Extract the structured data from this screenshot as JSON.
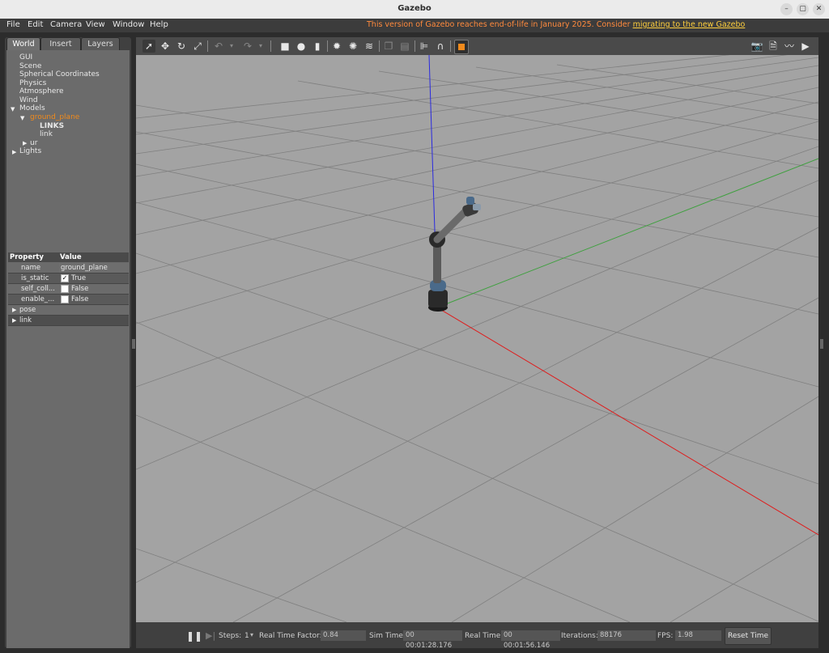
{
  "window": {
    "title": "Gazebo"
  },
  "menu": [
    "File",
    "Edit",
    "Camera",
    "View",
    "Window",
    "Help"
  ],
  "notice": {
    "text": "This version of Gazebo reaches end-of-life in January 2025. Consider ",
    "link": "migrating to the new Gazebo"
  },
  "tabs": [
    "World",
    "Insert",
    "Layers"
  ],
  "tree": {
    "gui": "GUI",
    "scene": "Scene",
    "spherical": "Spherical Coordinates",
    "physics": "Physics",
    "atmosphere": "Atmosphere",
    "wind": "Wind",
    "models": "Models",
    "ground_plane": "ground_plane",
    "links": "LINKS",
    "link": "link",
    "ur": "ur",
    "lights": "Lights"
  },
  "properties": {
    "header": {
      "property": "Property",
      "value": "Value"
    },
    "rows": [
      {
        "name": "name",
        "value": "ground_plane"
      },
      {
        "name": "is_static",
        "value": "True",
        "checked": true
      },
      {
        "name": "self_coll...",
        "value": "False",
        "checked": false
      },
      {
        "name": "enable_...",
        "value": "False",
        "checked": false
      }
    ],
    "groups": [
      "pose",
      "link"
    ]
  },
  "bottom": {
    "steps_label": "Steps:",
    "steps_value": "1",
    "rtf_label": "Real Time Factor:",
    "rtf_value": "0.84",
    "sim_label": "Sim Time:",
    "sim_value": "00 00:01:28.176",
    "real_label": "Real Time:",
    "real_value": "00 00:01:56.146",
    "iter_label": "Iterations:",
    "iter_value": "88176",
    "fps_label": "FPS:",
    "fps_value": "1.98",
    "reset_label": "Reset Time"
  },
  "colors": {
    "orange_accent": "#f08a1c",
    "scene_bg": "#a3a3a3",
    "axis_x": "#e01a1a",
    "axis_y": "#3fa03f",
    "axis_z": "#2a2ae0"
  }
}
